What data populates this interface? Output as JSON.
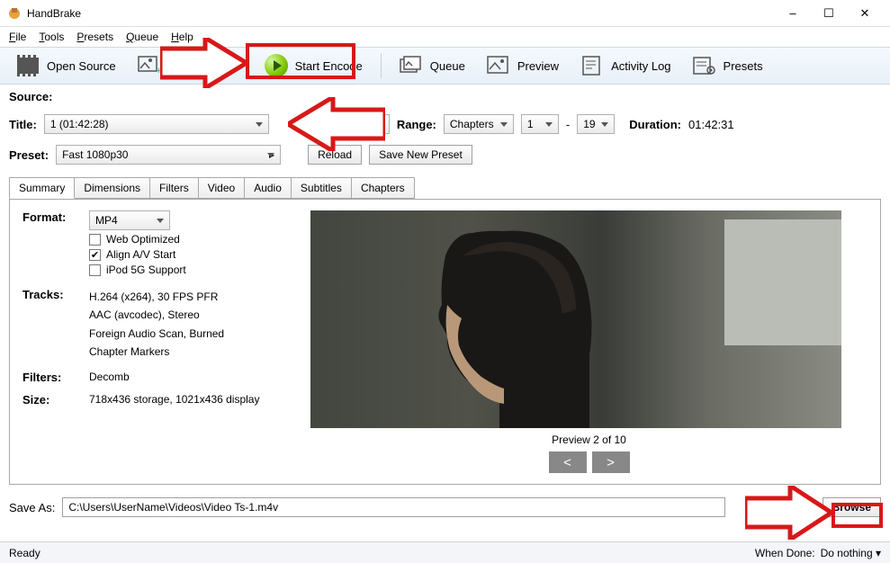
{
  "app": {
    "title": "HandBrake"
  },
  "window_controls": {
    "min": "–",
    "max": "☐",
    "close": "✕"
  },
  "menu": {
    "file": "File",
    "tools": "Tools",
    "presets": "Presets",
    "queue": "Queue",
    "help": "Help"
  },
  "toolbar": {
    "open_source": "Open Source",
    "start_encode": "Start Encode",
    "queue": "Queue",
    "preview": "Preview",
    "activity_log": "Activity Log",
    "presets": "Presets"
  },
  "source": {
    "label": "Source:"
  },
  "title_row": {
    "label": "Title:",
    "value": "1  (01:42:28)",
    "range_label": "Range:",
    "range_type": "Chapters",
    "range_start": "1",
    "range_sep": "-",
    "range_end": "19",
    "duration_label": "Duration:",
    "duration_value": "01:42:31"
  },
  "preset_row": {
    "label": "Preset:",
    "value": "Fast 1080p30",
    "reload": "Reload",
    "save_new": "Save New Preset"
  },
  "tabs": {
    "summary": "Summary",
    "dimensions": "Dimensions",
    "filters": "Filters",
    "video": "Video",
    "audio": "Audio",
    "subtitles": "Subtitles",
    "chapters": "Chapters"
  },
  "summary": {
    "format_label": "Format:",
    "format_value": "MP4",
    "web_optimized": "Web Optimized",
    "align_av": "Align A/V Start",
    "ipod": "iPod 5G Support",
    "tracks_label": "Tracks:",
    "tracks": {
      "t1": "H.264 (x264), 30 FPS PFR",
      "t2": "AAC (avcodec), Stereo",
      "t3": "Foreign Audio Scan, Burned",
      "t4": "Chapter Markers"
    },
    "filters_label": "Filters:",
    "filters_value": "Decomb",
    "size_label": "Size:",
    "size_value": "718x436 storage, 1021x436 display"
  },
  "preview": {
    "caption": "Preview 2 of 10",
    "prev": "<",
    "next": ">"
  },
  "saveas": {
    "label": "Save As:",
    "path": "C:\\Users\\UserName\\Videos\\Video Ts-1.m4v",
    "browse": "Browse"
  },
  "status": {
    "ready": "Ready",
    "when_done_label": "When Done:",
    "when_done_value": "Do nothing"
  }
}
